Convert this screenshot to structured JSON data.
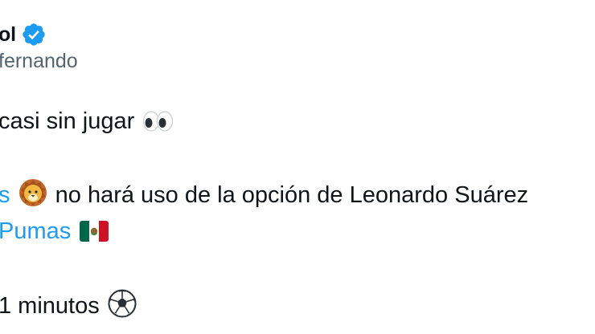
{
  "tweet": {
    "author": {
      "display_name_visible": "ol",
      "handle_visible": "fernando",
      "verified_badge_icon": "verified-badge-icon"
    },
    "lines": {
      "line1_text": "casi sin jugar",
      "line1_emoji": "eyes-emoji",
      "line2_link_fragment": "s",
      "line2_emoji": "lion-emoji",
      "line2_text": "no hará uso de la opción de Leonardo Suárez",
      "line3_link": "Pumas",
      "line3_emoji": "mexico-flag-emoji",
      "line4_text": "1 minutos",
      "line4_emoji": "soccer-ball-emoji"
    }
  },
  "colors": {
    "text": "#0f1419",
    "secondary_text": "#536471",
    "link": "#1d9bf0",
    "verified_badge": "#1d9bf0"
  }
}
